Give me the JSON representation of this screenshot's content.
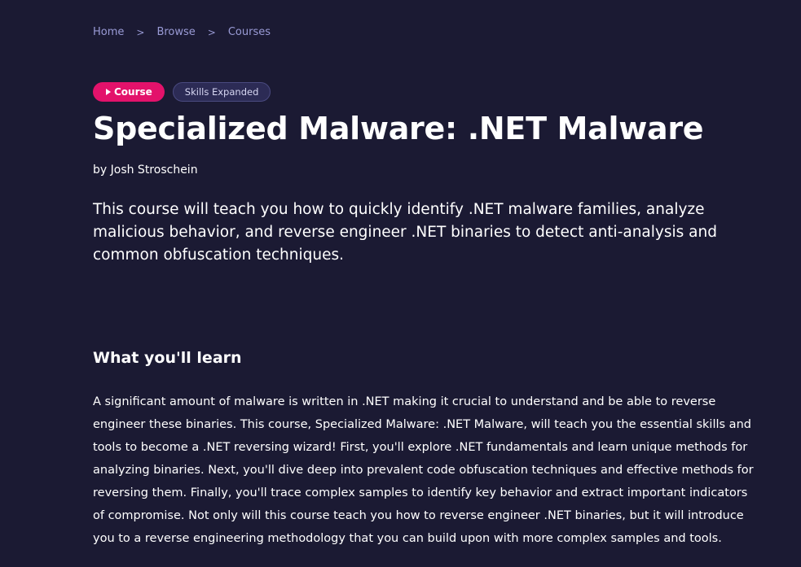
{
  "breadcrumb": {
    "items": [
      "Home",
      "Browse",
      "Courses"
    ],
    "separator": ">"
  },
  "tags": {
    "course_label": "Course",
    "skills_label": "Skills Expanded"
  },
  "course": {
    "title": "Specialized Malware: .NET Malware",
    "author": "by Josh Stroschein",
    "summary": "This course will teach you how to quickly identify .NET malware families, analyze malicious behavior, and reverse engineer .NET binaries to detect anti-analysis and common obfuscation techniques."
  },
  "learn": {
    "heading": "What you'll learn",
    "description": "A significant amount of malware is written in .NET making it crucial to understand and be able to reverse engineer these binaries. This course, Specialized Malware: .NET Malware, will teach you the essential skills and tools to become a .NET reversing wizard! First, you'll explore .NET fundamentals and learn unique methods for analyzing binaries. Next, you'll dive deep into prevalent code obfuscation techniques and effective methods for reversing them. Finally, you'll trace complex samples to identify key behavior and extract important indicators of compromise. Not only will this course teach you how to reverse engineer .NET binaries, but it will introduce you to a reverse engineering methodology that you can build upon with more complex samples and tools."
  },
  "colors": {
    "background": "#1b1a33",
    "accent": "#e3126b",
    "breadcrumb": "#9a9bd6",
    "skills_badge": "#2c2b55"
  }
}
